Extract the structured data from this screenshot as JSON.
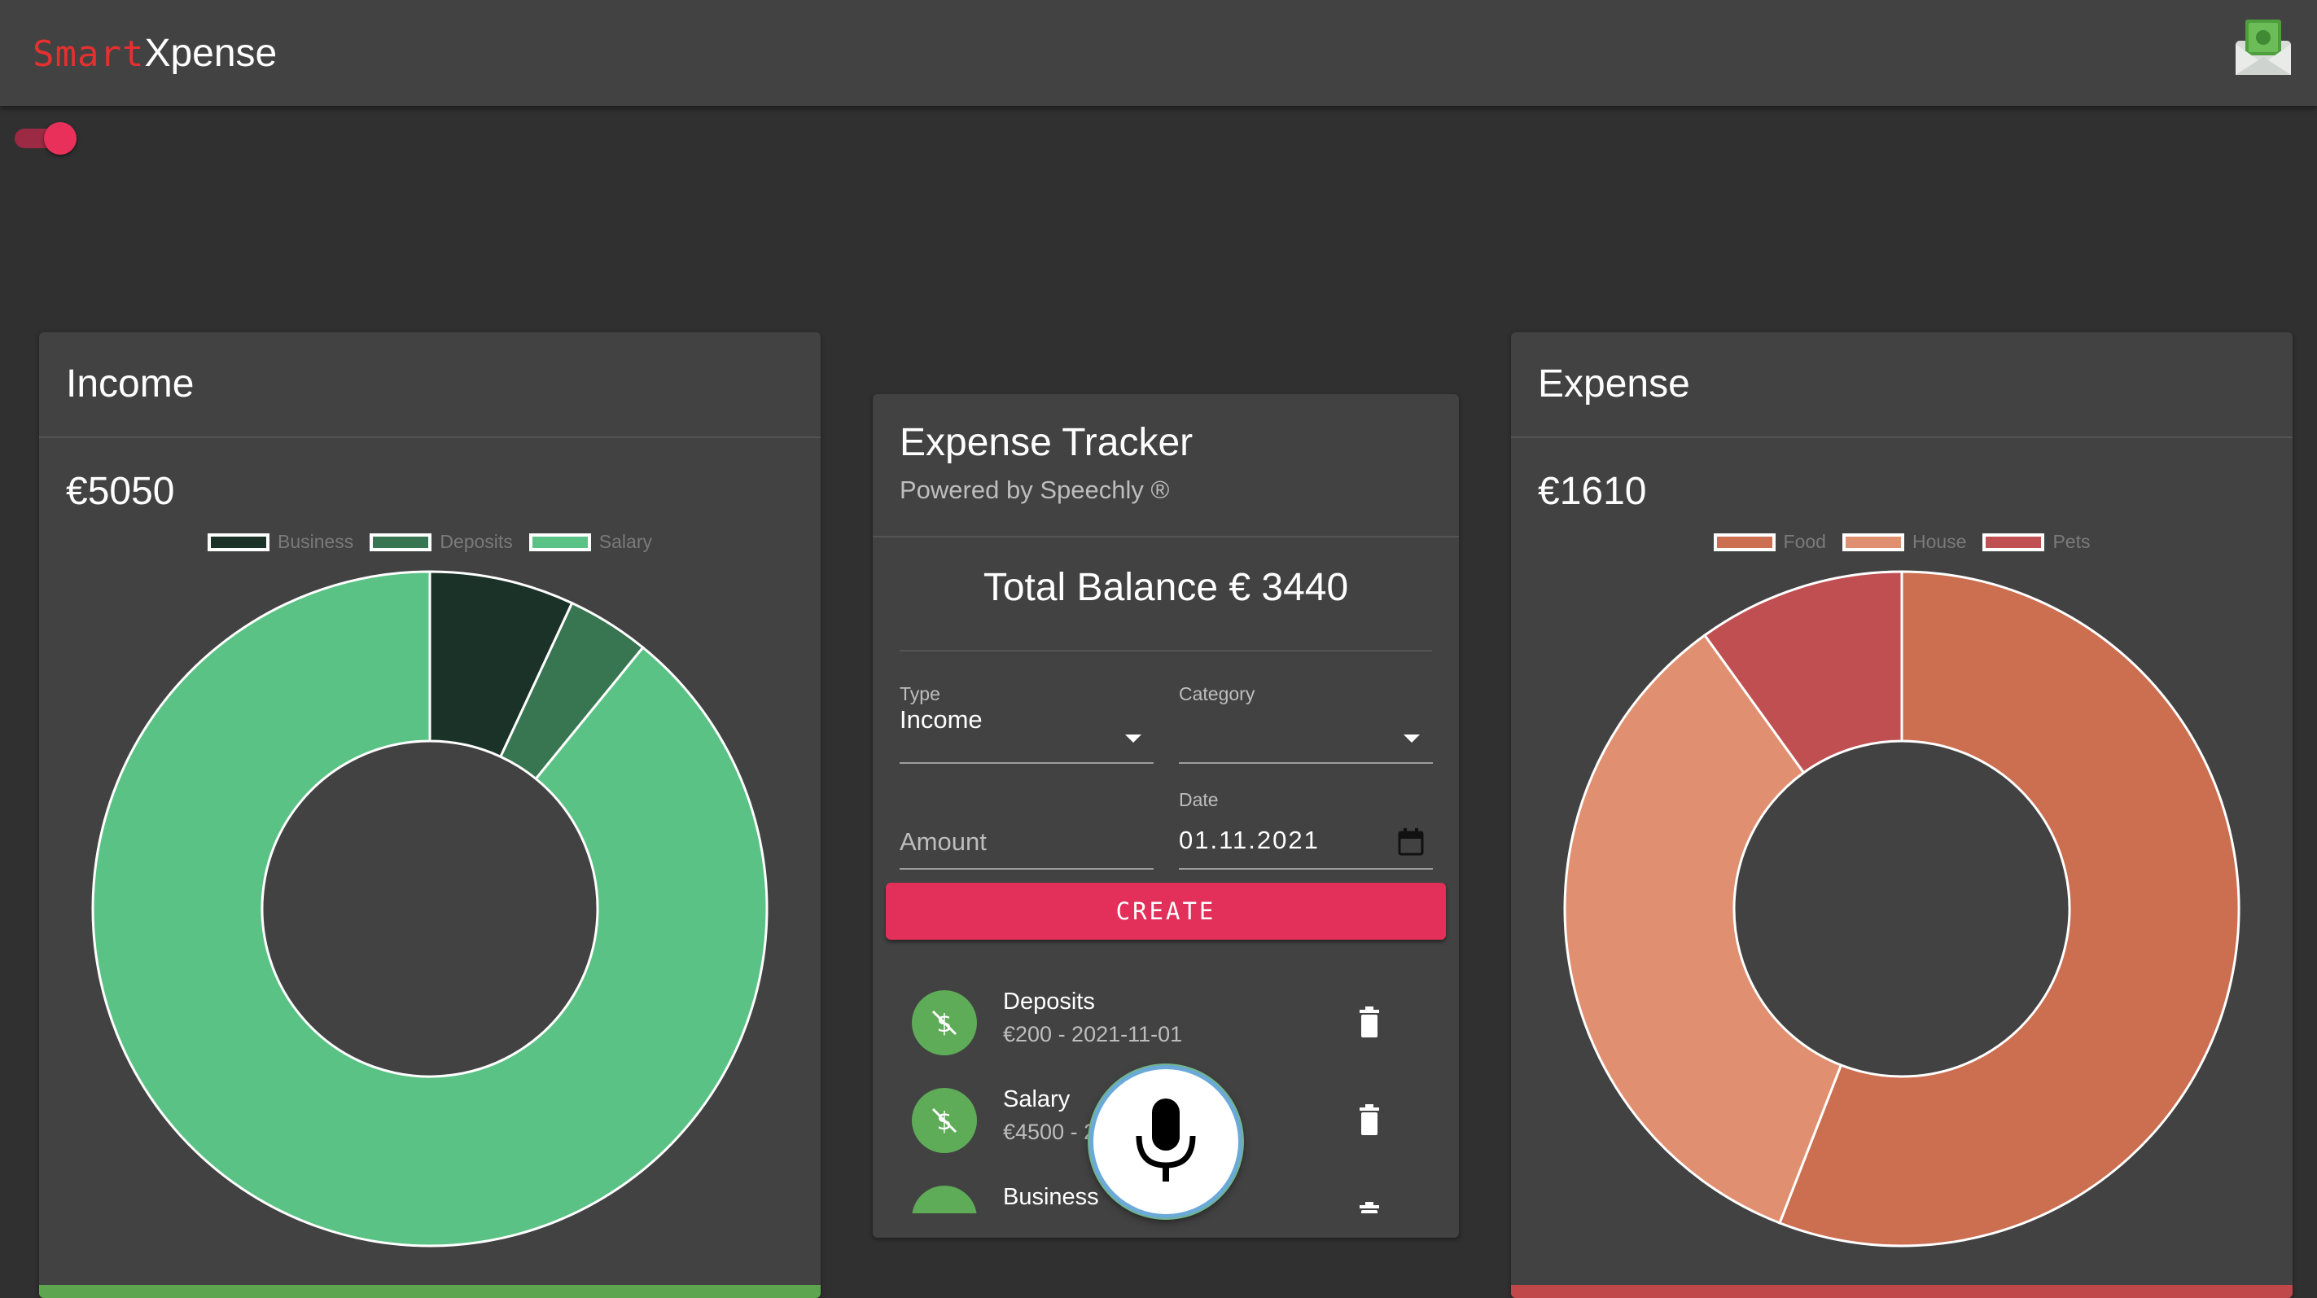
{
  "app": {
    "logo_part1": "Smart",
    "logo_part2": "Xpense",
    "icon": "money-envelope-icon"
  },
  "toggle": {
    "label": "theme-toggle",
    "state": "on",
    "color": "#e8305a"
  },
  "income": {
    "title": "Income",
    "total": "€5050",
    "bar_color": "#5ea54f",
    "chart_data": {
      "type": "pie",
      "donut": true,
      "labels": [
        "Business",
        "Deposits",
        "Salary"
      ],
      "values": [
        350,
        200,
        4500
      ],
      "colors": [
        "#1a3228",
        "#377651",
        "#5bc285"
      ],
      "legend": "top"
    }
  },
  "expense": {
    "title": "Expense",
    "total": "€1610",
    "bar_color": "#c0474a",
    "chart_data": {
      "type": "pie",
      "donut": true,
      "labels": [
        "Food",
        "House",
        "Pets"
      ],
      "values": [
        900,
        550,
        160
      ],
      "colors": [
        "#cc6e50",
        "#e09070",
        "#c04f52"
      ],
      "legend": "top"
    }
  },
  "tracker": {
    "title": "Expense Tracker",
    "subtitle": "Powered by Speechly ®",
    "balance": "Total Balance € 3440",
    "type_label": "Type",
    "type_value": "Income",
    "category_label": "Category",
    "category_value": "",
    "amount_placeholder": "Amount",
    "date_label": "Date",
    "date_value": "01.11.2021",
    "create_label": "CREATE",
    "transactions": [
      {
        "name": "Deposits",
        "detail": "€200 - 2021-11-01"
      },
      {
        "name": "Salary",
        "detail": "€4500 - 2021-11-01"
      },
      {
        "name": "Business",
        "detail": ""
      }
    ]
  },
  "mic": {
    "icon": "microphone-icon"
  }
}
